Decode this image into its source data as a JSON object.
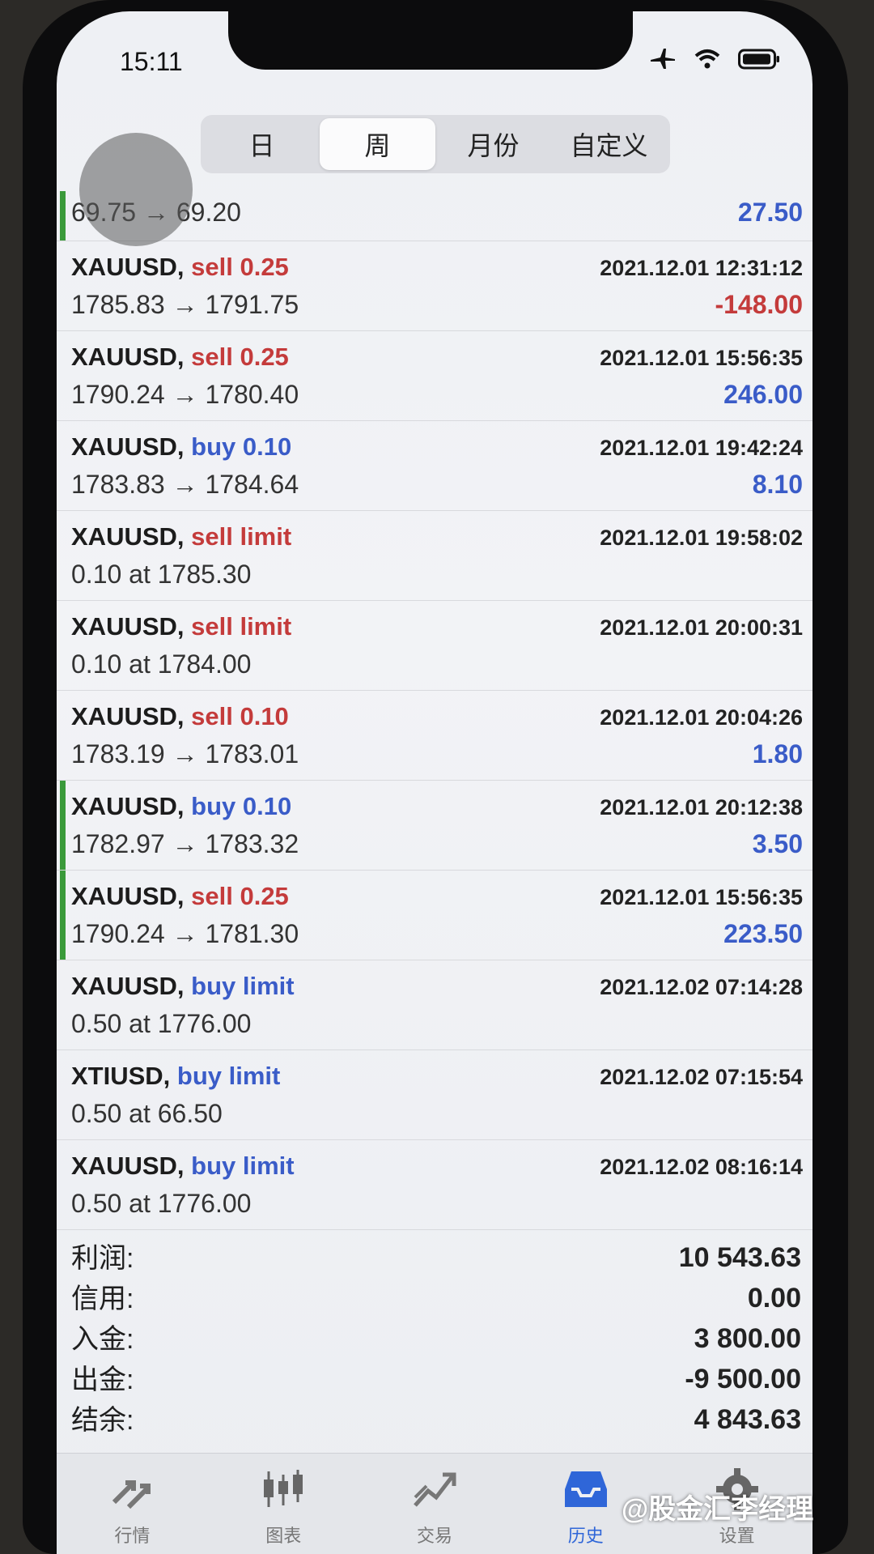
{
  "status": {
    "time": "15:11"
  },
  "period_tabs": [
    {
      "label": "日",
      "active": false
    },
    {
      "label": "周",
      "active": true
    },
    {
      "label": "月份",
      "active": false
    },
    {
      "label": "自定义",
      "active": false
    }
  ],
  "first_row": {
    "price": "69.75 → 69.20",
    "profit": "27.50"
  },
  "rows": [
    {
      "symbol": "XAUUSD,",
      "action": "sell 0.25",
      "time": "2021.12.01 12:31:12",
      "price": "1785.83 → 1791.75",
      "profit": "-148.00"
    },
    {
      "symbol": "XAUUSD,",
      "action": "sell 0.25",
      "time": "2021.12.01 15:56:35",
      "price": "1790.24 → 1780.40",
      "profit": "246.00"
    },
    {
      "symbol": "XAUUSD,",
      "action": "buy 0.10",
      "time": "2021.12.01 19:42:24",
      "price": "1783.83 → 1784.64",
      "profit": "8.10"
    },
    {
      "symbol": "XAUUSD,",
      "action": "sell limit",
      "time": "2021.12.01 19:58:02",
      "price": "0.10 at 1785.30",
      "profit": ""
    },
    {
      "symbol": "XAUUSD,",
      "action": "sell limit",
      "time": "2021.12.01 20:00:31",
      "price": "0.10 at 1784.00",
      "profit": ""
    },
    {
      "symbol": "XAUUSD,",
      "action": "sell 0.10",
      "time": "2021.12.01 20:04:26",
      "price": "1783.19 → 1783.01",
      "profit": "1.80"
    },
    {
      "symbol": "XAUUSD,",
      "action": "buy 0.10",
      "time": "2021.12.01 20:12:38",
      "price": "1782.97 → 1783.32",
      "profit": "3.50"
    },
    {
      "symbol": "XAUUSD,",
      "action": "sell 0.25",
      "time": "2021.12.01 15:56:35",
      "price": "1790.24 → 1781.30",
      "profit": "223.50"
    },
    {
      "symbol": "XAUUSD,",
      "action": "buy limit",
      "time": "2021.12.02 07:14:28",
      "price": "0.50 at 1776.00",
      "profit": ""
    },
    {
      "symbol": "XTIUSD,",
      "action": "buy limit",
      "time": "2021.12.02 07:15:54",
      "price": "0.50 at 66.50",
      "profit": ""
    },
    {
      "symbol": "XAUUSD,",
      "action": "buy limit",
      "time": "2021.12.02 08:16:14",
      "price": "0.50 at 1776.00",
      "profit": ""
    }
  ],
  "summary": [
    {
      "label": "利润:",
      "value": "10 543.63"
    },
    {
      "label": "信用:",
      "value": "0.00"
    },
    {
      "label": "入金:",
      "value": "3 800.00"
    },
    {
      "label": "出金:",
      "value": "-9 500.00"
    },
    {
      "label": "结余:",
      "value": "4 843.63"
    }
  ],
  "tabbar": [
    {
      "label": "行情",
      "icon": "quotes-arrows-icon",
      "active": false
    },
    {
      "label": "图表",
      "icon": "candlestick-chart-icon",
      "active": false
    },
    {
      "label": "交易",
      "icon": "trade-trend-icon",
      "active": false
    },
    {
      "label": "历史",
      "icon": "history-inbox-icon",
      "active": true
    },
    {
      "label": "设置",
      "icon": "gear-icon",
      "active": false
    }
  ],
  "watermark": "@股金汇李经理",
  "colors": {
    "sell": "#c43b3b",
    "buy": "#3a5cc8",
    "active_tab": "#2f66d8",
    "profit_bar": "#3a9a3a"
  }
}
